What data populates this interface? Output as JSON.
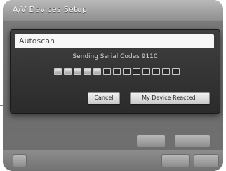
{
  "window": {
    "title": "A/V Devices Setup"
  },
  "dialog": {
    "title": "Autoscan",
    "status_text": "Sending Serial Codes 9110",
    "progress": {
      "filled_segments": 5,
      "total_segments": 13
    },
    "cancel_label": "Cancel",
    "found_label": "My Device Reacted!"
  },
  "colors": {
    "screen_bg": "#5e5e5e",
    "dialog_bg": "#2f2f2f",
    "dialog_header_bg": "#f7f7f7"
  }
}
